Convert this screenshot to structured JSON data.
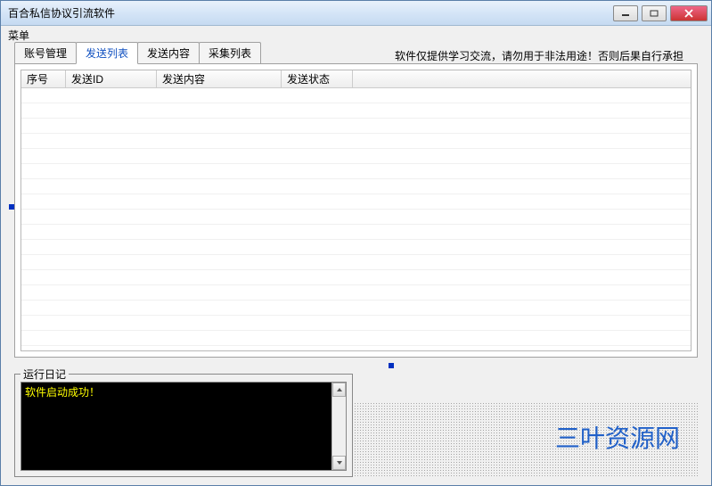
{
  "window": {
    "title": "百合私信协议引流软件"
  },
  "menubar": {
    "label": "菜单"
  },
  "tabs": [
    {
      "label": "账号管理"
    },
    {
      "label": "发送列表"
    },
    {
      "label": "发送内容"
    },
    {
      "label": "采集列表"
    }
  ],
  "warning": "软件仅提供学习交流，请勿用于非法用途！否则后果自行承担",
  "columns": {
    "c0": "序号",
    "c1": "发送ID",
    "c2": "发送内容",
    "c3": "发送状态"
  },
  "logbox": {
    "title": "运行日记",
    "line1": "软件启动成功！"
  },
  "watermark": "三叶资源网"
}
